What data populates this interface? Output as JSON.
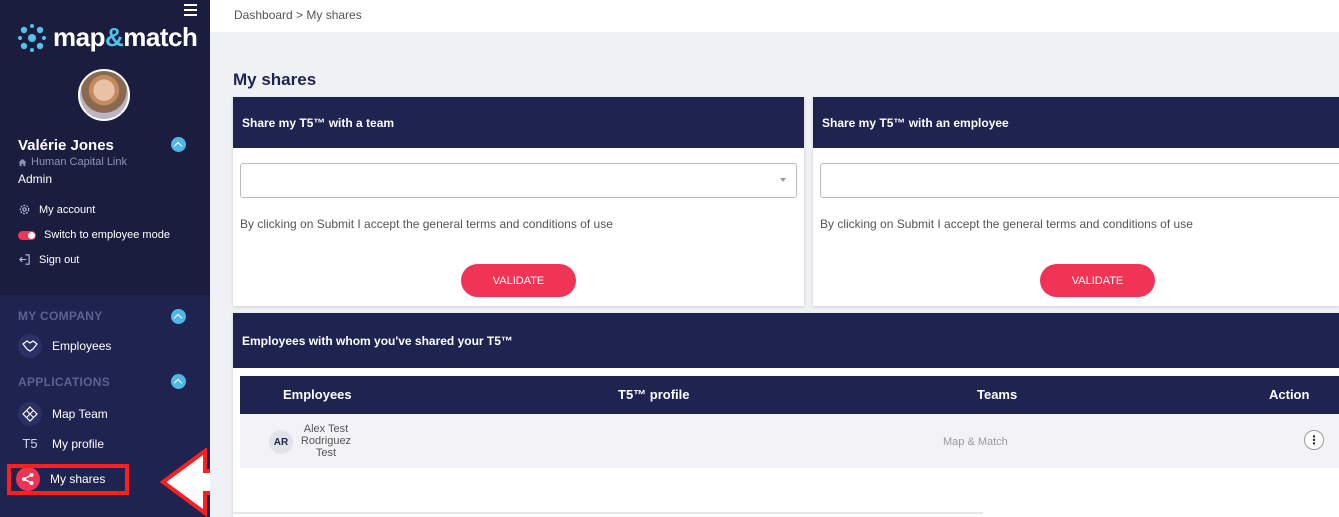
{
  "sidebar": {
    "brand": {
      "pre": "map",
      "amp": "&",
      "post": "match"
    },
    "user": {
      "name": "Valérie Jones",
      "company": "Human Capital Link",
      "role": "Admin"
    },
    "links": {
      "account": "My account",
      "switch": "Switch to employee mode",
      "signout": "Sign out"
    },
    "sections": {
      "company": "MY COMPANY",
      "apps": "APPLICATIONS"
    },
    "nav": {
      "employees": "Employees",
      "map_team": "Map Team",
      "profile_prefix": "T5",
      "profile": "My profile",
      "shares": "My shares"
    }
  },
  "header": {
    "breadcrumb": "Dashboard > My shares"
  },
  "page": {
    "title": "My shares"
  },
  "share_team": {
    "title": "Share my T5™ with a team",
    "terms": "By clicking on Submit I accept the general terms and conditions of use",
    "button": "VALIDATE"
  },
  "share_employee": {
    "title": "Share my T5™ with an employee",
    "terms": "By clicking on Submit I accept the general terms and conditions of use",
    "button": "VALIDATE"
  },
  "shared_table": {
    "title": "Employees with whom you've shared your T5™",
    "columns": {
      "employees": "Employees",
      "profile": "T5™ profile",
      "teams": "Teams",
      "action": "Action"
    },
    "rows": [
      {
        "initials": "AR",
        "name": "Alex Test Rodriguez Test",
        "team": "Map & Match"
      }
    ]
  },
  "colors": {
    "sidebar": "#1f2350",
    "accent": "#ef3455",
    "toggle": "#4fb8e6",
    "highlight": "#ff1f1f"
  }
}
